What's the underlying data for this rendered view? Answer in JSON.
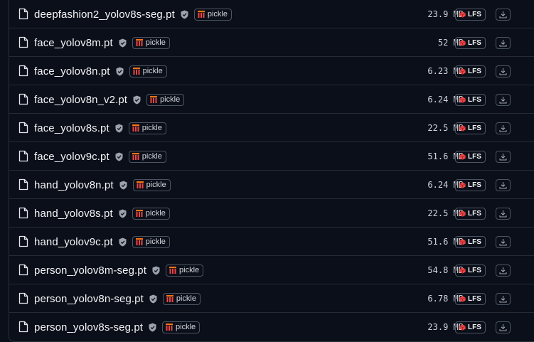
{
  "files": [
    {
      "name": "deepfashion2_yolov8s-seg.pt",
      "badge": "pickle",
      "size": "23.9 MB",
      "storage": "LFS"
    },
    {
      "name": "face_yolov8m.pt",
      "badge": "pickle",
      "size": "52 MB",
      "storage": "LFS"
    },
    {
      "name": "face_yolov8n.pt",
      "badge": "pickle",
      "size": "6.23 MB",
      "storage": "LFS"
    },
    {
      "name": "face_yolov8n_v2.pt",
      "badge": "pickle",
      "size": "6.24 MB",
      "storage": "LFS"
    },
    {
      "name": "face_yolov8s.pt",
      "badge": "pickle",
      "size": "22.5 MB",
      "storage": "LFS"
    },
    {
      "name": "face_yolov9c.pt",
      "badge": "pickle",
      "size": "51.6 MB",
      "storage": "LFS"
    },
    {
      "name": "hand_yolov8n.pt",
      "badge": "pickle",
      "size": "6.24 MB",
      "storage": "LFS"
    },
    {
      "name": "hand_yolov8s.pt",
      "badge": "pickle",
      "size": "22.5 MB",
      "storage": "LFS"
    },
    {
      "name": "hand_yolov9c.pt",
      "badge": "pickle",
      "size": "51.6 MB",
      "storage": "LFS"
    },
    {
      "name": "person_yolov8m-seg.pt",
      "badge": "pickle",
      "size": "54.8 MB",
      "storage": "LFS"
    },
    {
      "name": "person_yolov8n-seg.pt",
      "badge": "pickle",
      "size": "6.78 MB",
      "storage": "LFS"
    },
    {
      "name": "person_yolov8s-seg.pt",
      "badge": "pickle",
      "size": "23.9 MB",
      "storage": "LFS"
    }
  ],
  "colors": {
    "background": "#0b0f19",
    "lfs_accent": "#ef4444",
    "pickle_accent": "#f97316"
  },
  "icons": {
    "file": "file-icon",
    "scan": "shield-check-icon",
    "pickle": "pickle-icon",
    "lfs": "lfs-icon",
    "download": "download-icon"
  }
}
